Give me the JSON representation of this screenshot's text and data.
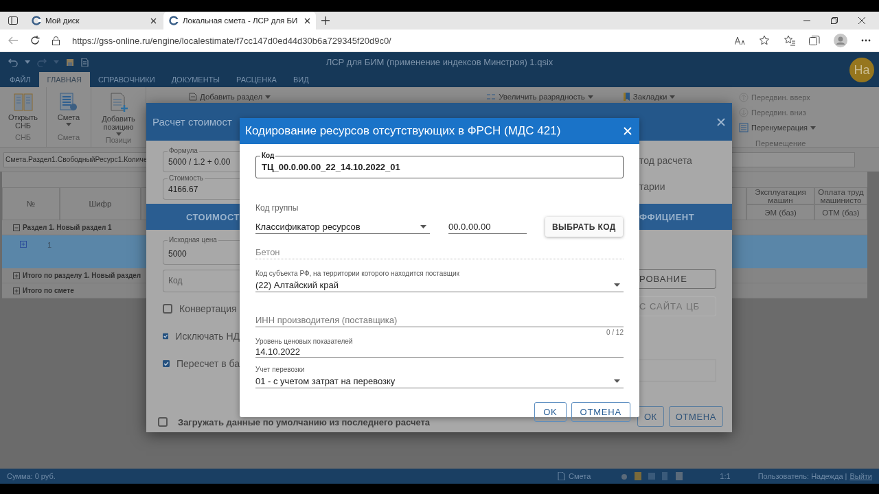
{
  "browser": {
    "tabs": [
      {
        "title": "Мой диск",
        "selected": false
      },
      {
        "title": "Локальная смета - ЛСР для БИ",
        "selected": true
      }
    ],
    "url": "https://gss-online.ru/engine/localestimate/f7cc147d0ed44d30b6a729345f20d9c0/"
  },
  "app": {
    "title": "ЛСР для БИМ (применение индексов Минстроя) 1.qsix",
    "avatar": "На",
    "menu": [
      {
        "label": "ФАЙЛ",
        "selected": false
      },
      {
        "label": "ГЛАВНАЯ",
        "selected": true
      },
      {
        "label": "СПРАВОЧНИКИ",
        "selected": false
      },
      {
        "label": "ДОКУМЕНТЫ",
        "selected": false
      },
      {
        "label": "РАСЦЕНКА",
        "selected": false
      },
      {
        "label": "ВИД",
        "selected": false
      }
    ]
  },
  "ribbon": {
    "left_groups": [
      {
        "label": "СНБ",
        "button": {
          "label": "Открыть СНБ",
          "dropdown": false
        }
      },
      {
        "label": "Смета",
        "button": {
          "label": "Смета",
          "dropdown": true
        }
      },
      {
        "label": "Позици",
        "button": {
          "label": "Добавить позицию",
          "dropdown": true
        }
      }
    ],
    "top_items": [
      {
        "label": "Добавить раздел",
        "dropdown": true
      },
      {
        "label": "Увеличить разрядность",
        "dropdown": true
      },
      {
        "label": "Закладки",
        "dropdown": true
      }
    ],
    "right_group": {
      "label": "Перемещение",
      "items": [
        {
          "label": "Передвин. вверх",
          "disabled": true
        },
        {
          "label": "Передвин. вниз",
          "disabled": true
        },
        {
          "label": "Перенумерация",
          "disabled": false
        }
      ]
    }
  },
  "formula_path": "Смета.Раздел1.СвободныйРесурс1.Количе",
  "table": {
    "columns_left": [
      "№",
      "Шифр"
    ],
    "columns_right": [
      {
        "title": "Эксплуатация машин",
        "sub": "ЭМ (баз)"
      },
      {
        "title": "Оплата труд машинисто",
        "sub": "ОТМ (баз)"
      }
    ],
    "rows": [
      {
        "kind": "section",
        "label": "Раздел 1. Новый раздел 1",
        "expanded": true
      },
      {
        "kind": "item",
        "number": "1",
        "selected": true,
        "expanded": false
      },
      {
        "kind": "total",
        "label": "Итого по разделу 1. Новый раздел",
        "expanded": false
      },
      {
        "kind": "total",
        "label": "Итого по смете",
        "expanded": false
      }
    ]
  },
  "status_bar": {
    "sum": "Сумма: 0 руб.",
    "mode": "Смета",
    "scale": "1:1",
    "user": "Пользователь: Надежда |",
    "logout": "Выйти"
  },
  "calc_dialog": {
    "title": "Расчет стоимост",
    "fields": [
      {
        "label": "Формула",
        "value": "5000 / 1.2 + 0.00"
      },
      {
        "label": "Стоимость",
        "value": "4166.67"
      }
    ],
    "tab_left": "СТОИМОСТ",
    "tab_right": "ФФИЦИЕНТ",
    "price": {
      "label": "Исходная цена",
      "value": "5000"
    },
    "code_placeholder": "Код",
    "checks": [
      {
        "label": "Конвертация",
        "checked": false
      },
      {
        "label": "Исключать НД",
        "checked": true
      },
      {
        "label": "Пересчет в ба",
        "checked": true
      }
    ],
    "right_texts": [
      "тод расчета",
      "тарии"
    ],
    "right_buttons": [
      {
        "label": "РОВАНИЕ",
        "disabled": false
      },
      {
        "label": "С САЙТА ЦБ",
        "disabled": true
      }
    ],
    "load_default": {
      "label": "Загружать данные по умолчанию из последнего расчета",
      "checked": false
    },
    "buttons": [
      "ОК",
      "ОТМЕНА"
    ]
  },
  "code_dialog": {
    "title": "Кодирование ресурсов отсутствующих в ФРСН (МДС 421)",
    "code": {
      "label": "Код",
      "value": "ТЦ_00.0.00.00_22_14.10.2022_01"
    },
    "group": {
      "label": "Код группы",
      "select": "Классификатор ресурсов",
      "value": "00.0.00.00",
      "button": "ВЫБРАТЬ КОД"
    },
    "name": {
      "value": "Бетон",
      "disabled": true
    },
    "region": {
      "label": "Код субъекта РФ, на территории которого находится поставщик",
      "value": "(22) Алтайский край"
    },
    "inn": {
      "placeholder": "ИНН производителя (поставщика)",
      "counter": "0 / 12"
    },
    "price_level": {
      "label": "Уровень ценовых показателей",
      "value": "14.10.2022"
    },
    "transport": {
      "label": "Учет перевозки",
      "value": "01 - с учетом затрат на перевозку"
    },
    "buttons": [
      "OK",
      "ОТМЕНА"
    ]
  }
}
